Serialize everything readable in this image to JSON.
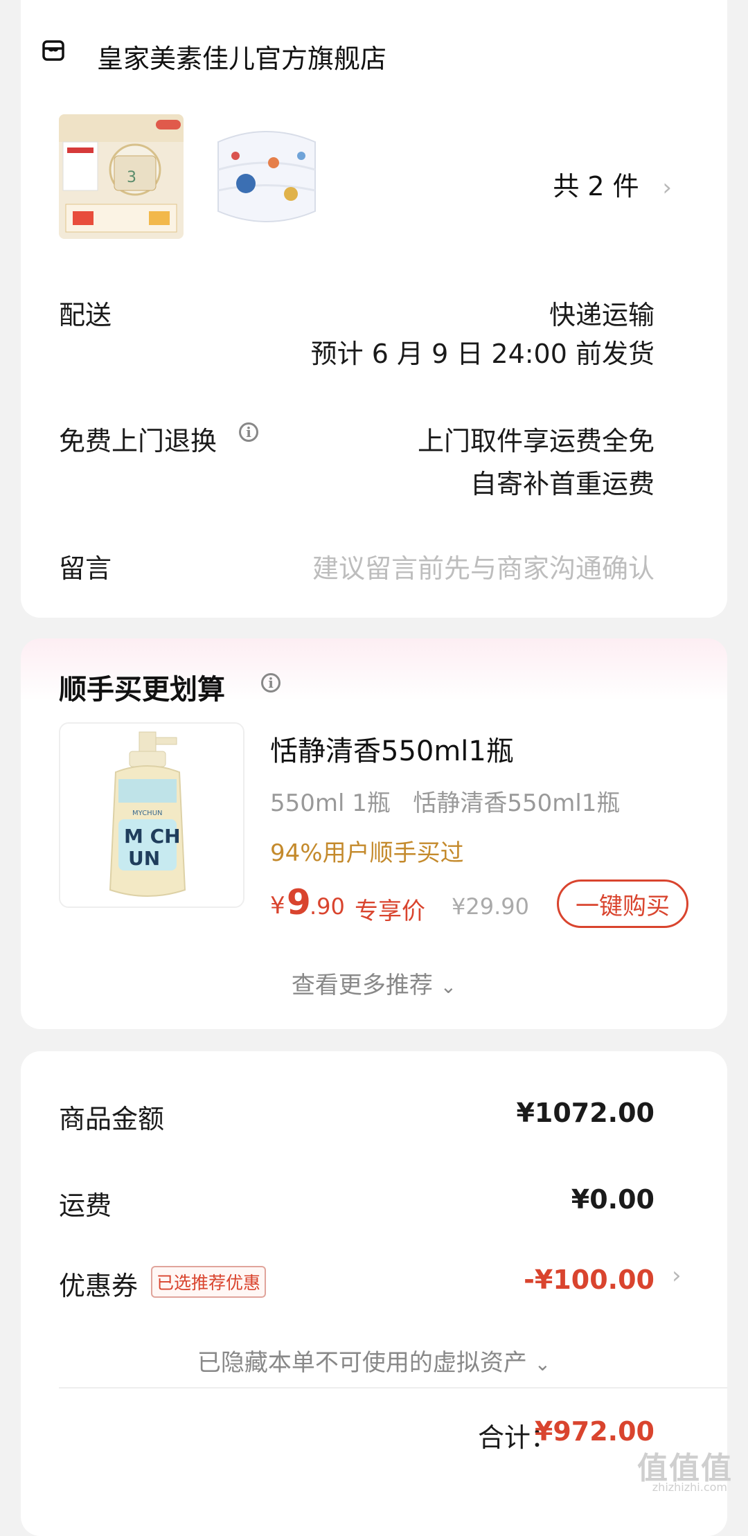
{
  "store": {
    "name": "皇家美素佳儿官方旗舰店",
    "icon": "store-icon"
  },
  "items": {
    "count_label": "共 2 件"
  },
  "delivery": {
    "label": "配送",
    "method": "快递运输",
    "eta": "预计 6 月 9 日 24:00 前发货"
  },
  "return_service": {
    "label": "免费上门退换",
    "line1": "上门取件享运费全免",
    "line2": "自寄补首重运费"
  },
  "message": {
    "label": "留言",
    "placeholder": "建议留言前先与商家沟通确认"
  },
  "recommend": {
    "title": "顺手买更划算",
    "product": {
      "name": "恬静清香550ml1瓶",
      "spec": "550ml 1瓶   恬静清香550ml1瓶",
      "percent_text": "94%用户顺手买过",
      "currency": "¥",
      "price_int": "9",
      "price_dec": ".90",
      "price_tag": "专享价",
      "original_price": "¥29.90",
      "buy_label": "一键购买",
      "bottle_brand": "MYCHUN",
      "bottle_logo": "M CH UN"
    },
    "more_label": "查看更多推荐"
  },
  "summary": {
    "goods_label": "商品金额",
    "goods_value": "¥1072.00",
    "shipping_label": "运费",
    "shipping_value": "¥0.00",
    "coupon_label": "优惠券",
    "coupon_badge": "已选推荐优惠",
    "coupon_value": "-¥100.00",
    "hidden_assets": "已隐藏本单不可使用的虚拟资产",
    "total_label": "合计：",
    "total_value": "¥972.00"
  },
  "watermark": {
    "text": "值值值",
    "sub": "zhizhizhi.com"
  },
  "colors": {
    "accent": "#d9442e",
    "muted": "#999999",
    "gold": "#c48a2c"
  }
}
